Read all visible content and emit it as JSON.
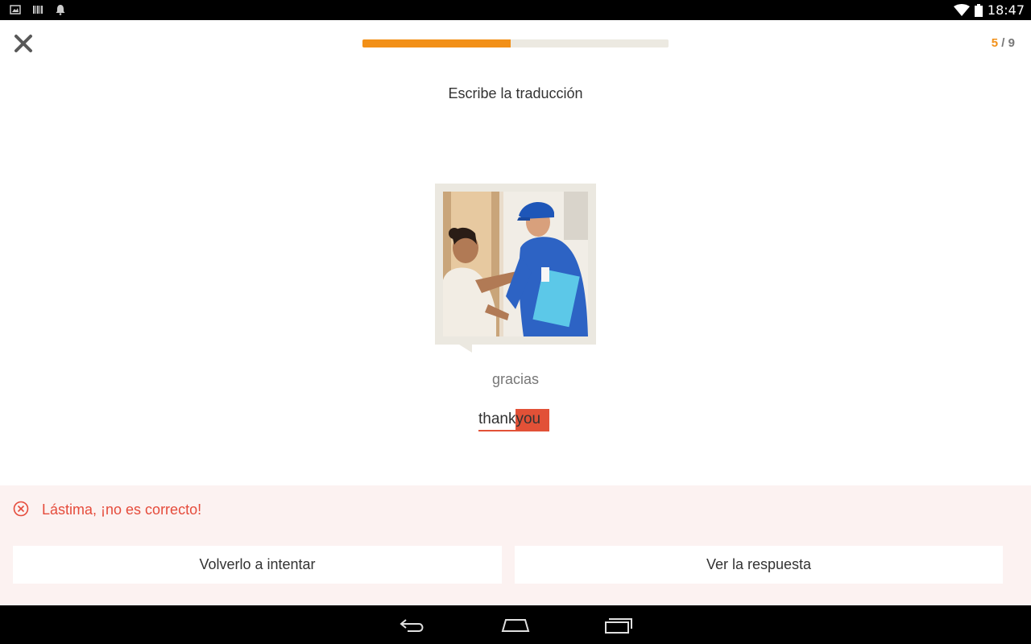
{
  "status_bar": {
    "time": "18:47",
    "icons": [
      "image-icon",
      "barcode-icon",
      "notification-bell-icon",
      "wifi-icon",
      "battery-icon"
    ]
  },
  "header": {
    "progress_fraction": 0.4842,
    "counter_current": "5",
    "counter_separator": " / ",
    "counter_total": "9",
    "progress_color": "#f29018"
  },
  "exercise": {
    "instruction": "Escribe la traducción",
    "prompt_word": "gracias",
    "answer_correct_part": "thank",
    "answer_wrong_part": "you",
    "error_color": "#e25137"
  },
  "feedback": {
    "message": "Lástima, ¡no es correcto!",
    "retry_label": "Volverlo a intentar",
    "show_answer_label": "Ver la respuesta",
    "background": "#fcf2f1"
  },
  "nav_bar": {
    "icons": [
      "back-icon",
      "home-icon",
      "recents-icon"
    ]
  }
}
